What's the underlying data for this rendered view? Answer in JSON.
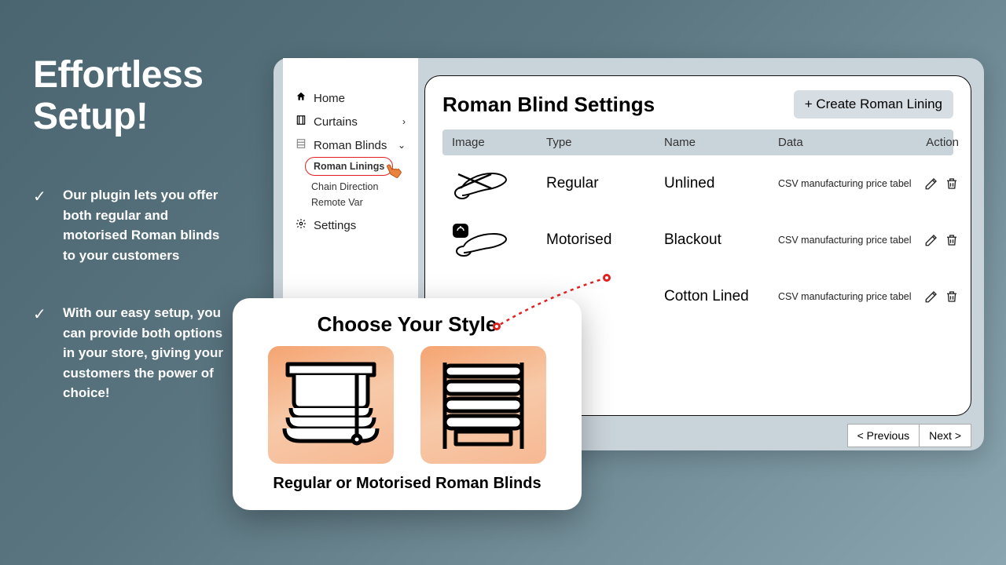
{
  "hero": {
    "title": "Effortless Setup!"
  },
  "bullets": [
    "Our plugin lets you offer both regular and motorised Roman blinds to your customers",
    "With our easy setup, you can provide both options in your store, giving your customers the power of choice!"
  ],
  "sidebar": {
    "items": [
      {
        "label": "Home"
      },
      {
        "label": "Curtains"
      },
      {
        "label": "Roman Blinds"
      },
      {
        "label": "Settings"
      }
    ],
    "sub": [
      {
        "label": "Roman Linings",
        "active": true
      },
      {
        "label": "Chain Direction"
      },
      {
        "label": "Remote Var"
      }
    ]
  },
  "panel": {
    "title": "Roman Blind Settings",
    "create_label": "+ Create Roman Lining",
    "columns": {
      "image": "Image",
      "type": "Type",
      "name": "Name",
      "data": "Data",
      "action": "Action"
    },
    "rows": [
      {
        "type": "Regular",
        "name": "Unlined",
        "data": "CSV manufacturing price tabel"
      },
      {
        "type": "Motorised",
        "name": "Blackout",
        "data": "CSV manufacturing price tabel"
      },
      {
        "type": "",
        "name": "Cotton Lined",
        "data": "CSV manufacturing price tabel"
      }
    ]
  },
  "pager": {
    "prev": "< Previous",
    "next": "Next >"
  },
  "style_card": {
    "title": "Choose Your Style",
    "caption": "Regular or Motorised Roman Blinds"
  }
}
